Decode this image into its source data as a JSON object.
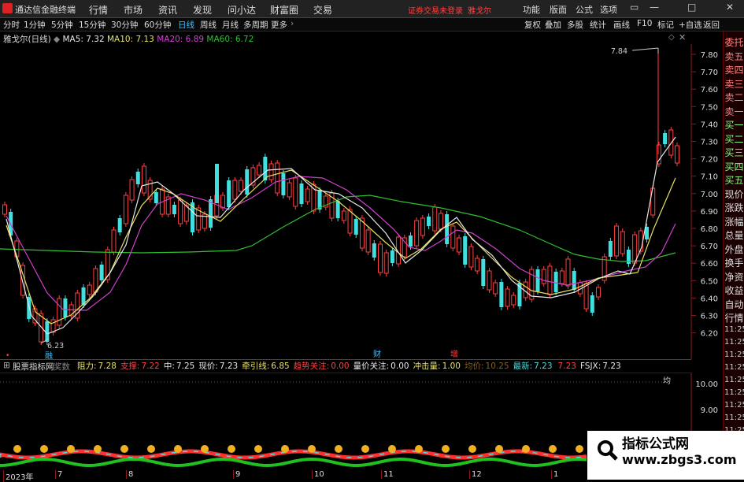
{
  "app": {
    "title": "通达信金融终端"
  },
  "menu": [
    "行情",
    "市场",
    "资讯",
    "发现",
    "问小达",
    "财富圈",
    "交易"
  ],
  "warning": "证券交易未登录",
  "stock_title": "雅戈尔",
  "right_menu": [
    "功能",
    "版面",
    "公式",
    "选项"
  ],
  "win_btns": [
    "▭",
    "—",
    "□",
    "✕"
  ],
  "periods": [
    "分时",
    "1分钟",
    "5分钟",
    "15分钟",
    "30分钟",
    "60分钟",
    "日线",
    "周线",
    "月线",
    "多周期",
    "更多"
  ],
  "tool_right": [
    "复权",
    "叠加",
    "多股",
    "统计",
    "画线",
    "F10",
    "标记",
    "+自选",
    "返回"
  ],
  "legend": {
    "name": "雅戈尔(日线)",
    "ma5": "MA5: 7.32",
    "ma10": "MA10: 7.13",
    "ma20": "MA20: 6.89",
    "ma60": "MA60: 6.72",
    "colors": {
      "ma5": "#e8e8e8",
      "ma10": "#e8e060",
      "ma20": "#d040d0",
      "ma60": "#30c030"
    }
  },
  "price_axis": [
    "7.80",
    "7.70",
    "7.60",
    "7.50",
    "7.40",
    "7.30",
    "7.20",
    "7.10",
    "7.00",
    "6.90",
    "6.80",
    "6.70",
    "6.60",
    "6.50",
    "6.40",
    "6.30",
    "6.20"
  ],
  "annotations": {
    "high": "7.84",
    "low": "6.23"
  },
  "markers": [
    {
      "text": "财"
    },
    {
      "text": "增"
    },
    {
      "text": "融"
    }
  ],
  "right_tabs": [
    "委托",
    "卖五",
    "卖四",
    "卖三",
    "卖二",
    "卖一",
    "买一",
    "买二",
    "买三",
    "买四",
    "买五",
    "现价",
    "涨跌",
    "涨幅",
    "总量",
    "外盘",
    "换手",
    "净资",
    "收益",
    "自动",
    "行情"
  ],
  "right_times": [
    "11:25",
    "11:25",
    "11:25",
    "11:25",
    "11:25",
    "11:25",
    "11:25",
    "11:25",
    "11:25",
    "11:25",
    "11:25",
    "11:25"
  ],
  "indicator_bar": {
    "name": "股票指标网",
    "items": [
      {
        "label": "阻力:",
        "value": "7.28",
        "color": "#e8e060"
      },
      {
        "label": "支撑:",
        "value": "7.22",
        "color": "#ff4040"
      },
      {
        "label": "中:",
        "value": "7.25",
        "color": "#e8e8e8"
      },
      {
        "label": "现价:",
        "value": "7.23",
        "color": "#e8e8e8"
      },
      {
        "label": "牵引线:",
        "value": "6.85",
        "color": "#e8e060"
      },
      {
        "label": "趋势关注:",
        "value": "0.00",
        "color": "#ff4040"
      },
      {
        "label": "量价关注:",
        "value": "0.00",
        "color": "#e8e8e8"
      },
      {
        "label": "冲击量:",
        "value": "1.00",
        "color": "#e8e060"
      },
      {
        "label": "均价:",
        "value": "10.25",
        "color": "#806020"
      },
      {
        "label": "最新:",
        "value": "7.23",
        "color": "#40e0e0"
      },
      {
        "label": "",
        "value": "7.23",
        "color": "#ff4040"
      },
      {
        "label": "FSJX:",
        "value": "7.23",
        "color": "#e8e8e8"
      }
    ]
  },
  "sub_axis": [
    "10.00",
    "9.00",
    "8.00"
  ],
  "sub_label": "均",
  "date_labels": [
    "2023年",
    "7",
    "8",
    "9",
    "10",
    "11",
    "12",
    "1"
  ],
  "watermark": {
    "line1": "指标公式网",
    "line2": "www.zbgs3.com"
  }
}
